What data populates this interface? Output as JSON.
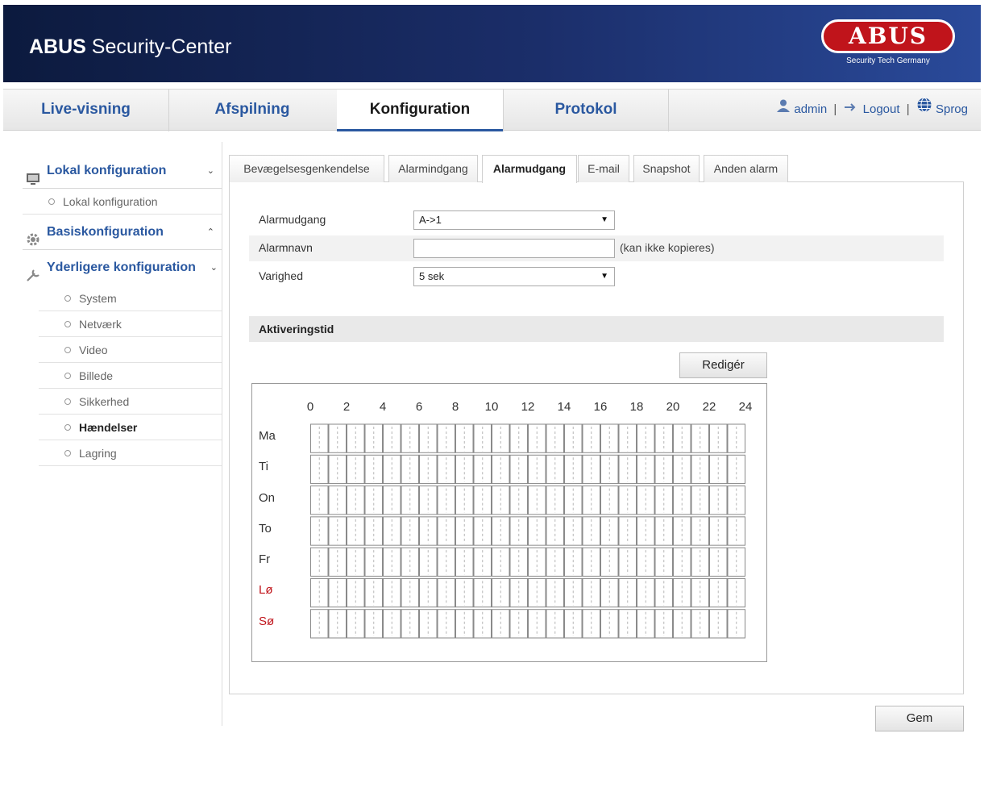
{
  "header": {
    "brand_bold": "ABUS",
    "brand_rest": " Security-Center",
    "logo_text": "ABUS",
    "logo_tagline": "Security Tech Germany"
  },
  "nav": {
    "items": [
      {
        "label": "Live-visning"
      },
      {
        "label": "Afspilning"
      },
      {
        "label": "Konfiguration"
      },
      {
        "label": "Protokol"
      }
    ],
    "user": "admin",
    "logout": "Logout",
    "language": "Sprog",
    "divider": "|"
  },
  "sidebar": {
    "local": {
      "label": "Lokal konfiguration",
      "sub": "Lokal konfiguration"
    },
    "basic": {
      "label": "Basiskonfiguration"
    },
    "advanced": {
      "label": "Yderligere konfiguration",
      "items": [
        "System",
        "Netværk",
        "Video",
        "Billede",
        "Sikkerhed",
        "Hændelser",
        "Lagring"
      ]
    }
  },
  "tabs": [
    "Bevægelsesgenkendelse",
    "Alarmindgang",
    "Alarmudgang",
    "E-mail",
    "Snapshot",
    "Anden alarm"
  ],
  "form": {
    "alarm_output": {
      "label": "Alarmudgang",
      "value": "A->1"
    },
    "alarm_name": {
      "label": "Alarmnavn",
      "value": "",
      "hint": "(kan ikke kopieres)"
    },
    "duration": {
      "label": "Varighed",
      "value": "5 sek"
    }
  },
  "schedule": {
    "section_title": "Aktiveringstid",
    "edit_label": "Redigér",
    "hours": [
      "0",
      "2",
      "4",
      "6",
      "8",
      "10",
      "12",
      "14",
      "16",
      "18",
      "20",
      "22",
      "24"
    ],
    "days": [
      "Ma",
      "Ti",
      "On",
      "To",
      "Fr",
      "Lø",
      "Sø"
    ],
    "weekend_color": "#c0141b"
  },
  "save_label": "Gem",
  "colors": {
    "accent": "#2a58a0",
    "header": "#1b2e6a",
    "logo_red": "#c0141b"
  }
}
